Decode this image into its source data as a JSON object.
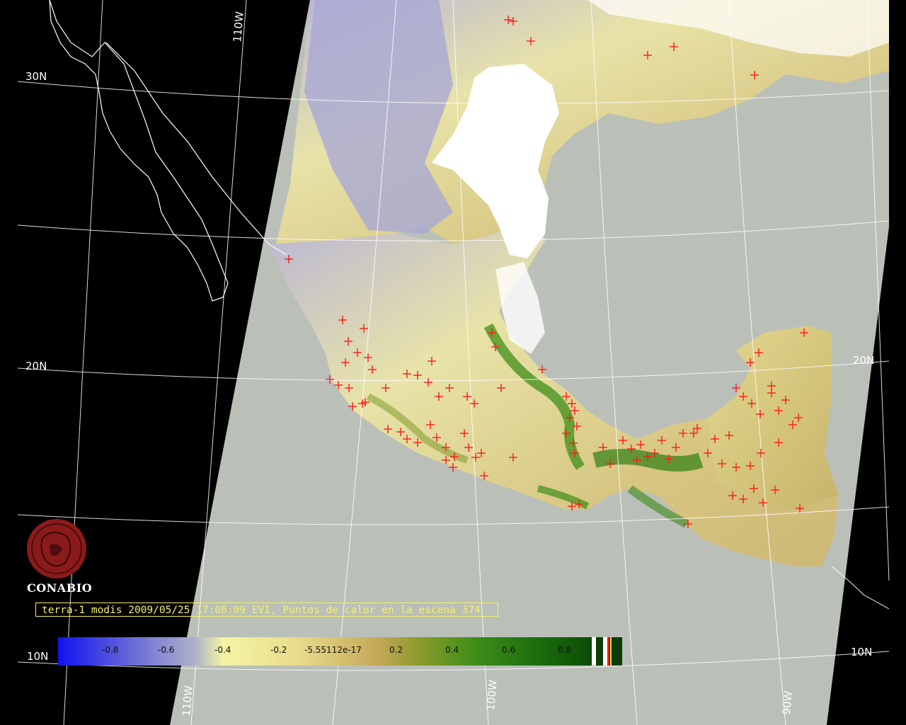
{
  "grid_labels": {
    "lat_30n": "30N",
    "lat_20n_left": "20N",
    "lat_20n_right": "20N",
    "lat_10n_left": "10N",
    "lat_10n_right": "10N",
    "lon_110w_top": "110W",
    "lon_110w_bottom": "110W",
    "lon_100w_bottom": "100W",
    "lon_90w_bottom": "90W"
  },
  "logo": {
    "text": "CONABIO"
  },
  "caption": "terra-1 modis 2009/05/25 17:06:09 EVI, Puntos de calor en la escena 374",
  "colorbar": {
    "ticks": [
      "-0.8",
      "-0.6",
      "-0.4",
      "-0.2",
      "-5.55112e-17",
      "0.2",
      "0.4",
      "0.6",
      "0.8"
    ]
  },
  "colors": {
    "background": "#000000",
    "ocean": "#babfb8",
    "land_low": "#f2efa2",
    "land_mid": "#d6c47a",
    "vegetation": "#3f8f18",
    "cloud": "#ffffff",
    "hotspot": "#ff1a1a",
    "caption": "#f5f06a"
  },
  "icons": {
    "logo": "conabio-seal-icon",
    "hotspot": "cross-marker-icon"
  }
}
